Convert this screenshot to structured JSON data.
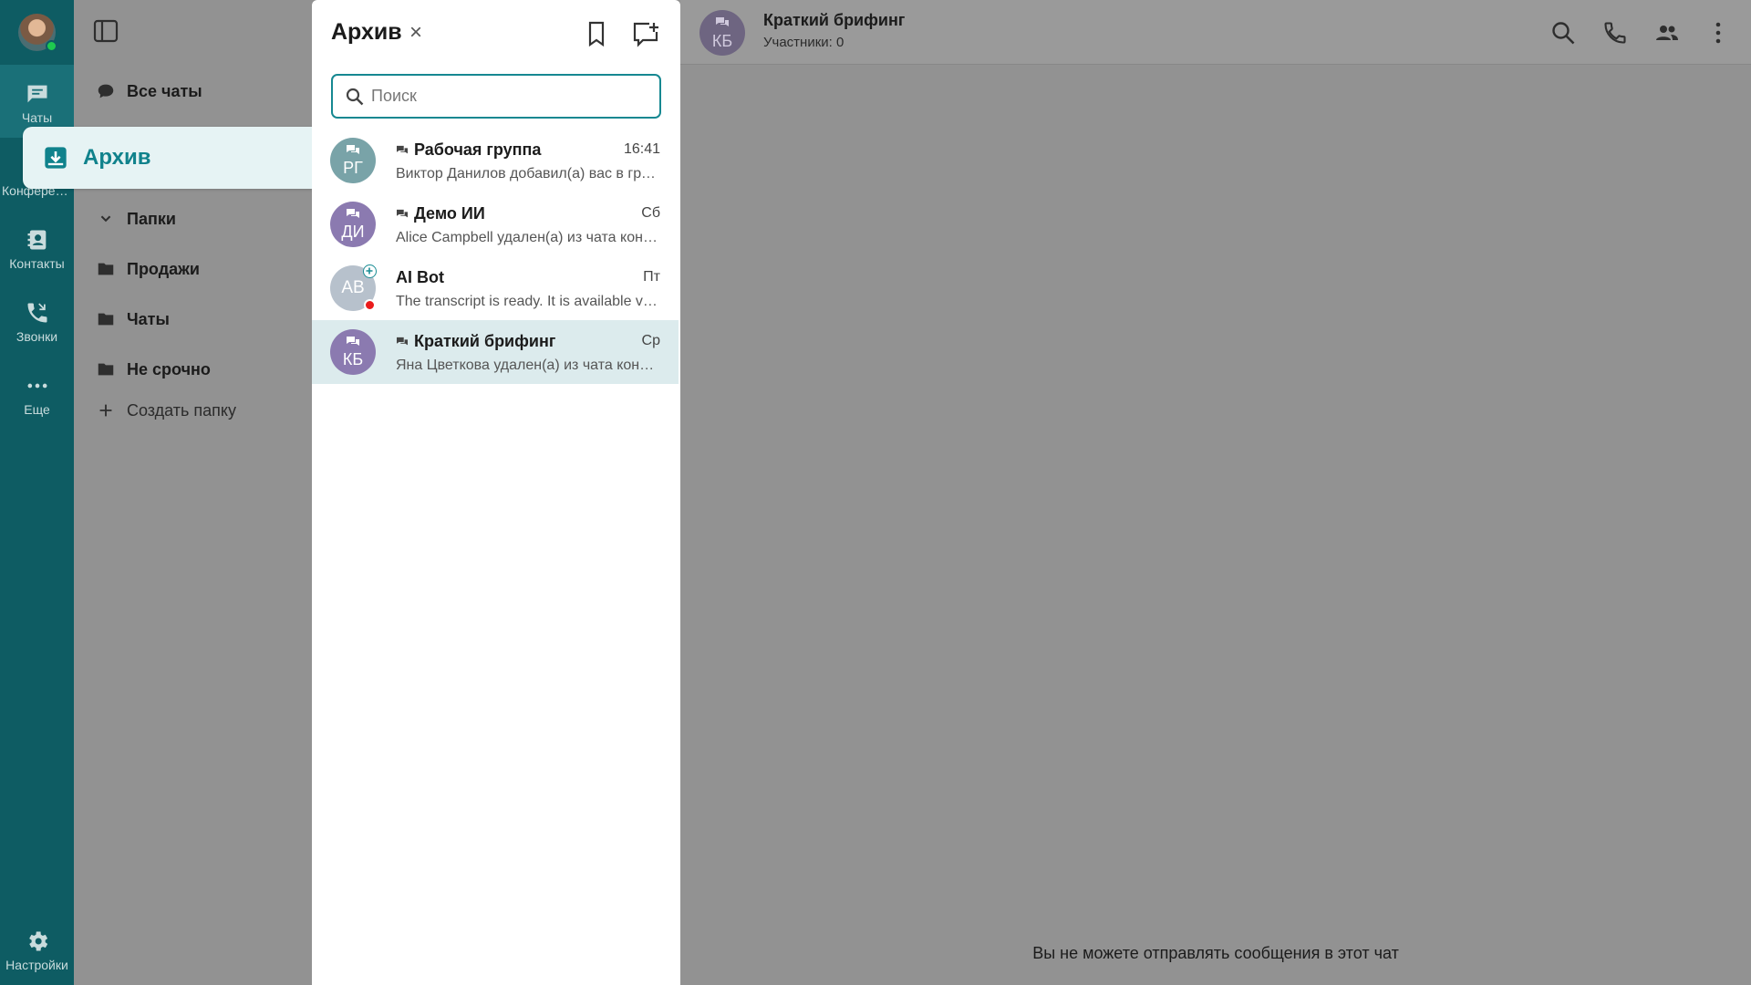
{
  "rail": {
    "items": [
      {
        "label": "Чаты",
        "icon": "chat-icon"
      },
      {
        "label": "Конференции",
        "icon": "conference-icon"
      },
      {
        "label": "Контакты",
        "icon": "contacts-icon"
      },
      {
        "label": "Звонки",
        "icon": "calls-icon"
      },
      {
        "label": "Еще",
        "icon": "more-icon"
      }
    ],
    "settings_label": "Настройки"
  },
  "folders": {
    "all_chats": "Все чаты",
    "archive": "Архив",
    "folders_header": "Папки",
    "items": [
      "Продажи",
      "Чаты",
      "Не срочно"
    ],
    "create_folder": "Создать папку"
  },
  "archive_panel": {
    "title": "Архив",
    "close_glyph": "×",
    "search_placeholder": "Поиск",
    "chats": [
      {
        "initials": "РГ",
        "name": "Рабочая группа",
        "time": "16:41",
        "preview": "Виктор Данилов добавил(а) вас в группу",
        "group": true,
        "avatar_color": "#79a3a8"
      },
      {
        "initials": "ДИ",
        "name": "Демо ИИ",
        "time": "Сб",
        "preview": "Alice Campbell удален(а) из чата конференции",
        "group": true,
        "avatar_color": "#8b7ab0"
      },
      {
        "initials": "AB",
        "name": "AI Bot",
        "time": "Пт",
        "preview": "The transcript  is ready. It is available via link",
        "group": false,
        "avatar_color": "#b7c1cc"
      },
      {
        "initials": "КБ",
        "name": "Краткий брифинг",
        "time": "Ср",
        "preview": "Яна Цветкова удален(а) из чата конференции",
        "group": true,
        "avatar_color": "#8b7ab0"
      }
    ]
  },
  "main": {
    "title": "Краткий брифинг",
    "initials": "КБ",
    "subtitle": "Участники: 0",
    "footer": "Вы не можете отправлять сообщения в этот чат"
  },
  "colors": {
    "rail": "#0e5c63",
    "accent": "#168891",
    "overlay": "#929292"
  }
}
